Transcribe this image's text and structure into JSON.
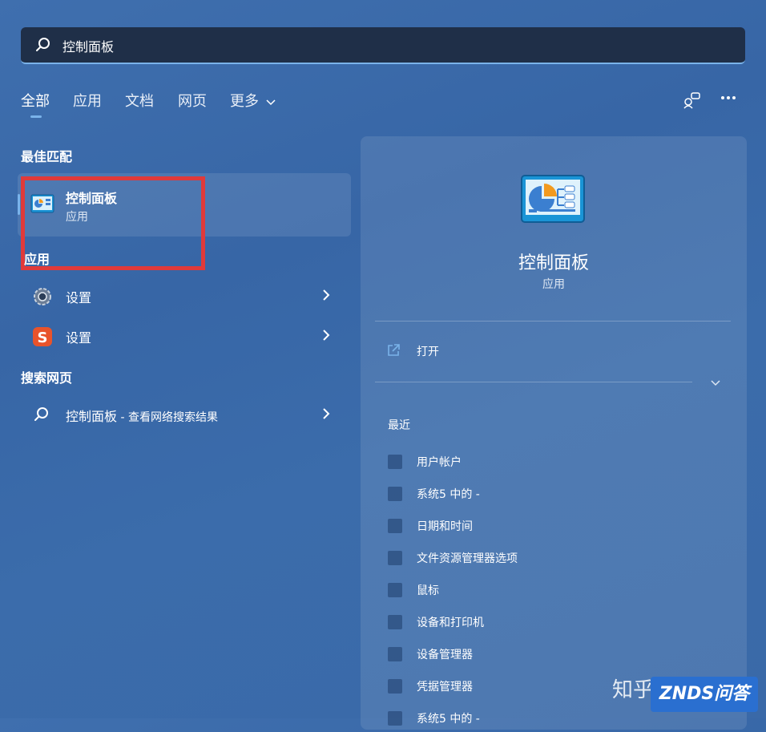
{
  "search": {
    "query": "控制面板",
    "icon": "search-icon"
  },
  "tabs": [
    {
      "label": "全部",
      "active": true
    },
    {
      "label": "应用",
      "active": false
    },
    {
      "label": "文档",
      "active": false
    },
    {
      "label": "网页",
      "active": false
    },
    {
      "label": "更多",
      "active": false,
      "dropdown": true
    }
  ],
  "top_icons": [
    "share-icon",
    "more-icon"
  ],
  "left": {
    "best_match_head": "最佳匹配",
    "best_match": {
      "title": "控制面板",
      "subtitle": "应用",
      "icon": "control-panel-icon"
    },
    "apps_head": "应用",
    "apps": [
      {
        "label": "设置",
        "icon": "gear-icon"
      },
      {
        "label": "设置",
        "icon": "sogou-icon"
      }
    ],
    "web_head": "搜索网页",
    "web": {
      "label": "控制面板",
      "suffix": " - 查看网络搜索结果",
      "icon": "search-icon"
    }
  },
  "panel": {
    "title": "控制面板",
    "subtitle": "应用",
    "open_label": "打开",
    "recent_head": "最近",
    "recent": [
      "用户帐户",
      "系统5 中的 -",
      "日期和时间",
      "文件资源管理器选项",
      "鼠标",
      "设备和打印机",
      "设备管理器",
      "凭据管理器",
      "系统5 中的 -"
    ]
  },
  "watermark": {
    "zhihu": "知乎",
    "brand": "ZNDS问答"
  },
  "colors": {
    "accent": "#7ab3ea",
    "highlight": "#e03a3a",
    "search_bg": "#1f2f48"
  }
}
